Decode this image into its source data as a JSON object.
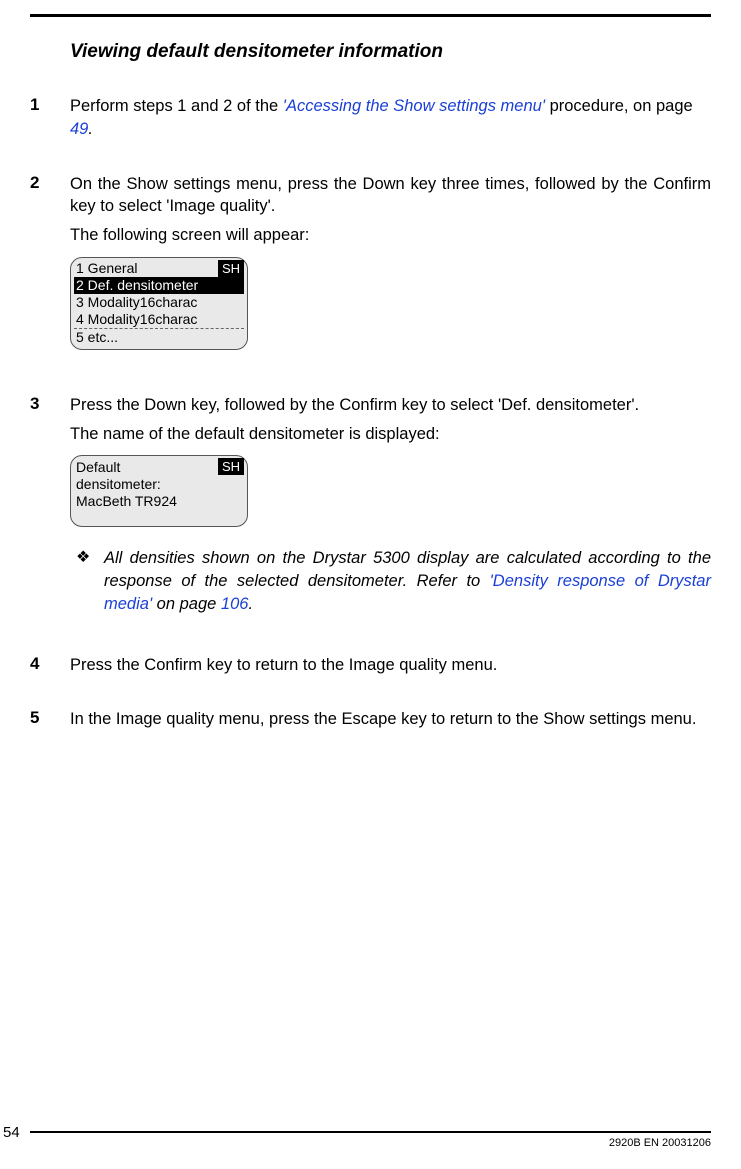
{
  "heading": "Viewing default densitometer information",
  "steps": {
    "s1": {
      "num": "1",
      "pre": "Perform steps 1 and 2 of the ",
      "link": "'Accessing the Show settings menu'",
      "mid": " procedure, on page ",
      "page": "49",
      "post": "."
    },
    "s2": {
      "num": "2",
      "line1": "On the Show settings menu, press the Down key three times, followed by the Confirm key to select 'Image quality'.",
      "line2": "The following screen will appear:"
    },
    "lcd1": {
      "badge": "SH",
      "r1": "1 General",
      "r2": "2 Def. densitometer",
      "r3": "3 Modality16charac",
      "r4": "4 Modality16charac",
      "r5": "5 etc..."
    },
    "s3": {
      "num": "3",
      "line1": "Press the Down key, followed by the Confirm key to select 'Def. densitometer'.",
      "line2": "The name of the default densitometer is displayed:"
    },
    "lcd2": {
      "badge": "SH",
      "l1": "Default",
      "l2": "densitometer:",
      "l3": "MacBeth TR924"
    },
    "note": {
      "bullet": "❖",
      "pre": "All densities shown on the Drystar 5300 display are calculated according to the response of the selected densitometer. Refer to ",
      "link": "'Density response of Drystar media'",
      "mid": " on page ",
      "page": "106",
      "post": "."
    },
    "s4": {
      "num": "4",
      "line1": "Press the Confirm key to return to the Image quality menu."
    },
    "s5": {
      "num": "5",
      "line1": "In the Image quality menu, press the Escape key to return to the Show settings menu."
    }
  },
  "footer": {
    "pagenum": "54",
    "docid": "2920B EN 20031206"
  }
}
